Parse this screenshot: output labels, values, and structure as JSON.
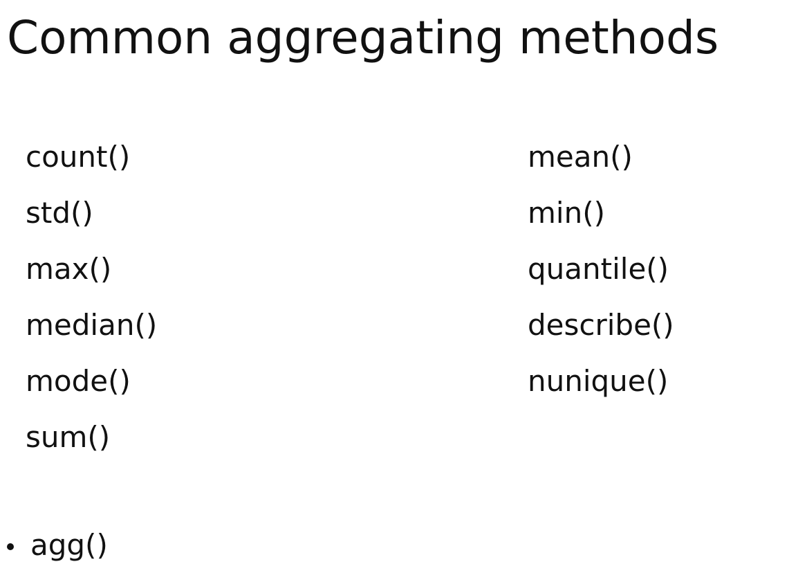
{
  "slide": {
    "title": "Common aggregating methods",
    "left_column": [
      "count()",
      "std()",
      "max()",
      "median()",
      "mode()",
      "sum()"
    ],
    "right_column": [
      "mean()",
      "min()",
      "quantile()",
      "describe()",
      "nunique()"
    ],
    "bullet": "agg()"
  }
}
